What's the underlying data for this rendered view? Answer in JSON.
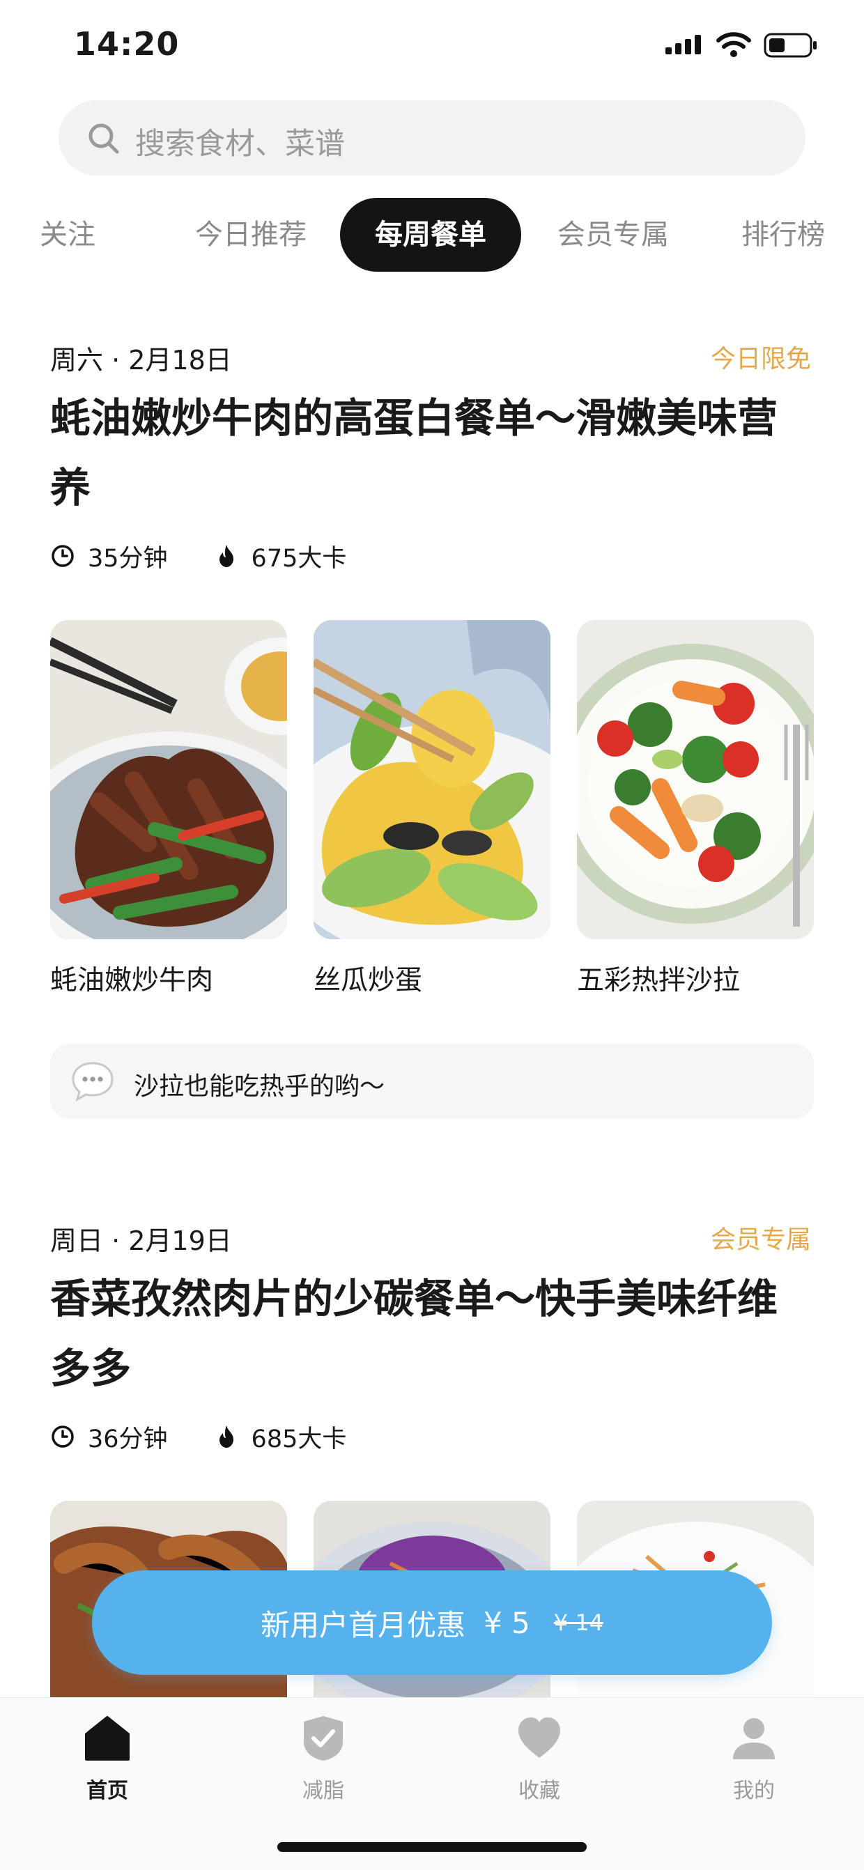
{
  "status_bar": {
    "time": "14:20"
  },
  "search": {
    "placeholder": "搜索食材、菜谱"
  },
  "tabs": [
    {
      "label": "关注"
    },
    {
      "label": "今日推荐"
    },
    {
      "label": "每周餐单",
      "active": true
    },
    {
      "label": "会员专属"
    },
    {
      "label": "排行榜"
    }
  ],
  "menus": [
    {
      "date": "周六 · 2月18日",
      "badge": "今日限免",
      "title": "蚝油嫩炒牛肉的高蛋白餐单～滑嫩美味营养",
      "time": "35分钟",
      "calories": "675大卡",
      "dishes": [
        "蚝油嫩炒牛肉",
        "丝瓜炒蛋",
        "五彩热拌沙拉"
      ],
      "tip": "沙拉也能吃热乎的哟～"
    },
    {
      "date": "周日 · 2月19日",
      "badge": "会员专属",
      "title": "香菜孜然肉片的少碳餐单～快手美味纤维多多",
      "time": "36分钟",
      "calories": "685大卡"
    }
  ],
  "promo": {
    "text": "新用户首月优惠",
    "price": "¥ 5",
    "original_price": "¥ 14"
  },
  "bottom_nav": [
    {
      "label": "首页",
      "icon": "home-icon",
      "active": true
    },
    {
      "label": "减脂",
      "icon": "shield-check-icon"
    },
    {
      "label": "收藏",
      "icon": "heart-icon"
    },
    {
      "label": "我的",
      "icon": "user-icon"
    }
  ],
  "colors": {
    "badge": "#e4a84a",
    "promo": "#56b2ec",
    "active_tab": "#141414"
  }
}
